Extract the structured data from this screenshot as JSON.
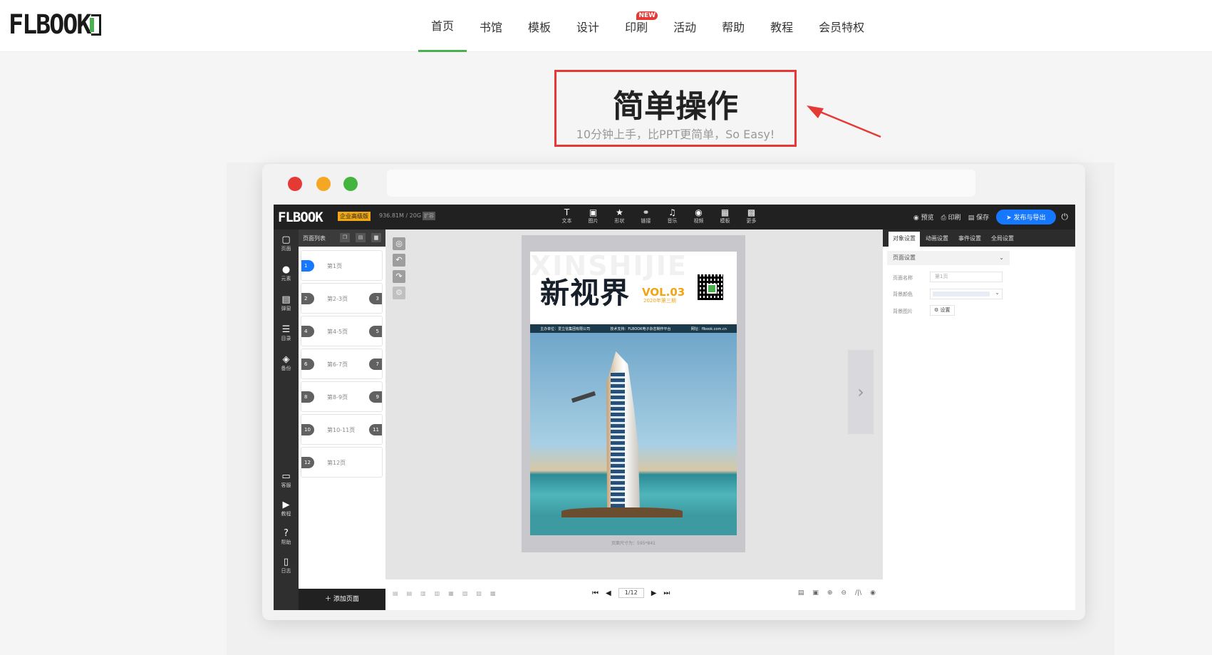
{
  "site": {
    "logo": "FLBOOK",
    "nav": [
      {
        "label": "首页",
        "active": true
      },
      {
        "label": "书馆"
      },
      {
        "label": "模板"
      },
      {
        "label": "设计"
      },
      {
        "label": "印刷",
        "badge": "NEW"
      },
      {
        "label": "活动"
      },
      {
        "label": "帮助"
      },
      {
        "label": "教程"
      },
      {
        "label": "会员特权"
      }
    ]
  },
  "hero": {
    "title": "简单操作",
    "subtitle": "10分钟上手，比PPT更简单，So Easy!"
  },
  "window_dots": [
    "#e53935",
    "#f5a623",
    "#43b53e"
  ],
  "editor": {
    "logo": "FLBOOK",
    "edition": "企业高级版",
    "storage": "936.81M / 20G",
    "storage_tag": "扩容",
    "tools": [
      {
        "icon": "text-icon",
        "glyph": "T",
        "label": "文本"
      },
      {
        "icon": "image-icon",
        "glyph": "▣",
        "label": "图片"
      },
      {
        "icon": "shape-icon",
        "glyph": "★",
        "label": "形状"
      },
      {
        "icon": "link-icon",
        "glyph": "⚭",
        "label": "链接"
      },
      {
        "icon": "music-icon",
        "glyph": "♫",
        "label": "音乐"
      },
      {
        "icon": "video-icon",
        "glyph": "◉",
        "label": "视频"
      },
      {
        "icon": "template-icon",
        "glyph": "▦",
        "label": "模板"
      },
      {
        "icon": "more-icon",
        "glyph": "▩",
        "label": "更多"
      }
    ],
    "actions": {
      "preview": "预览",
      "print": "印刷",
      "save": "保存",
      "publish": "发布与导出"
    },
    "rail": [
      {
        "icon": "page-icon",
        "glyph": "▢",
        "label": "页面"
      },
      {
        "icon": "element-icon",
        "glyph": "●",
        "label": "元素"
      },
      {
        "icon": "popup-icon",
        "glyph": "▤",
        "label": "弹窗"
      },
      {
        "icon": "toc-icon",
        "glyph": "☰",
        "label": "目录"
      },
      {
        "icon": "backup-icon",
        "glyph": "◈",
        "label": "备份"
      }
    ],
    "rail_bottom": [
      {
        "icon": "service-icon",
        "glyph": "▭",
        "label": "客服"
      },
      {
        "icon": "tutorial-icon",
        "glyph": "▶",
        "label": "教程"
      },
      {
        "icon": "help-icon",
        "glyph": "?",
        "label": "帮助"
      },
      {
        "icon": "log-icon",
        "glyph": "▯",
        "label": "日志"
      }
    ],
    "page_list": {
      "title": "页面列表",
      "add_page": "添加页面",
      "pages": [
        {
          "left": "1",
          "label": "第1页",
          "right": ""
        },
        {
          "left": "2",
          "label": "第2-3页",
          "right": "3"
        },
        {
          "left": "4",
          "label": "第4-5页",
          "right": "5"
        },
        {
          "left": "6",
          "label": "第6-7页",
          "right": "7"
        },
        {
          "left": "8",
          "label": "第8-9页",
          "right": "9"
        },
        {
          "left": "10",
          "label": "第10-11页",
          "right": "11"
        },
        {
          "left": "12",
          "label": "第12页",
          "right": ""
        }
      ]
    },
    "cover": {
      "watermark": "XINSHIJIE",
      "title": "新视界",
      "volume": "VOL.03",
      "issue": "2020年第三期",
      "info": [
        "主办单位：爱立信集团有限公司",
        "技术支持：FLBOOK电子杂志制作平台",
        "网址：flbook.com.cn"
      ],
      "size_note": "页面尺寸为：595*841"
    },
    "right_panel": {
      "tabs": [
        "对象设置",
        "动画设置",
        "事件设置",
        "全局设置"
      ],
      "section": "页面设置",
      "page_name_label": "页面名称",
      "page_name_value": "第1页",
      "bg_color_label": "背景颜色",
      "bg_image_label": "背景图片",
      "set_button": "设置"
    },
    "pager": "1/12"
  }
}
